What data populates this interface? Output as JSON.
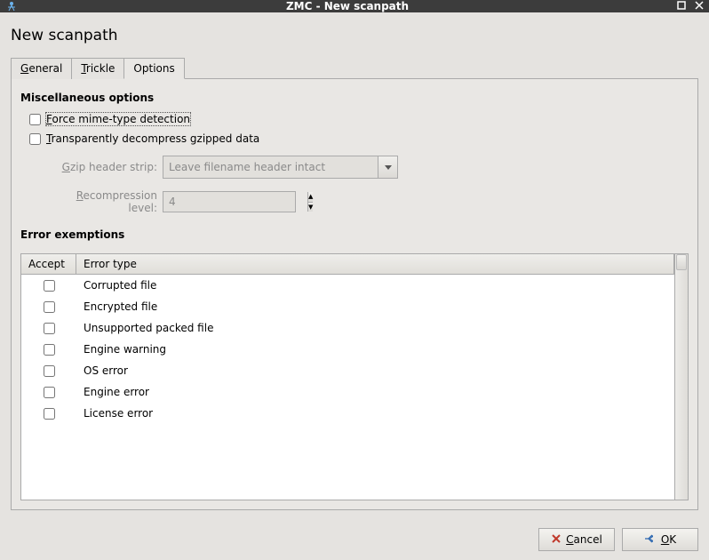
{
  "window": {
    "title": "ZMC - New scanpath"
  },
  "heading": "New scanpath",
  "tabs": [
    {
      "label": "General"
    },
    {
      "label": "Trickle"
    },
    {
      "label": "Options"
    }
  ],
  "activeTab": 2,
  "misc": {
    "title": "Miscellaneous options",
    "forceMime": {
      "label": "Force mime-type detection",
      "checked": false
    },
    "transparentGzip": {
      "label": "Transparently decompress gzipped data",
      "checked": false
    },
    "gzipStrip": {
      "label": "Gzip header strip:",
      "value": "Leave filename header intact"
    },
    "recompression": {
      "label": "Recompression level:",
      "value": "4"
    }
  },
  "errors": {
    "title": "Error exemptions",
    "columns": {
      "accept": "Accept",
      "type": "Error type"
    },
    "rows": [
      {
        "accept": false,
        "type": "Corrupted file"
      },
      {
        "accept": false,
        "type": "Encrypted file"
      },
      {
        "accept": false,
        "type": "Unsupported packed file"
      },
      {
        "accept": false,
        "type": "Engine warning"
      },
      {
        "accept": false,
        "type": "OS error"
      },
      {
        "accept": false,
        "type": "Engine error"
      },
      {
        "accept": false,
        "type": "License error"
      }
    ]
  },
  "buttons": {
    "cancel": "Cancel",
    "ok": "OK"
  }
}
